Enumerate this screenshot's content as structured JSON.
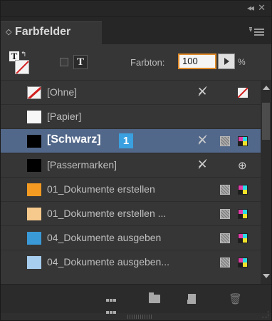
{
  "titlebar": {
    "collapse_glyph": "◂◂",
    "close_glyph": "✕"
  },
  "panel": {
    "tab_title": "Farbfelder",
    "tab_icon": "◇",
    "menu_icon": "panel-menu-icon"
  },
  "toolbar": {
    "text_button_label": "T",
    "fill_text_glyph": "T",
    "swap_glyph": "↰",
    "tint_label": "Farbton:",
    "tint_value": "100",
    "tint_unit": "%"
  },
  "swatches": [
    {
      "name": "[Ohne]",
      "swatch_color": "none",
      "icons": [
        "noedit",
        "none-mode"
      ]
    },
    {
      "name": "[Papier]",
      "swatch_color": "#f7f7f7",
      "icons": []
    },
    {
      "name": "[Schwarz]",
      "swatch_color": "#000000",
      "selected": true,
      "badge": "1",
      "icons": [
        "noedit",
        "process",
        "cmyk"
      ]
    },
    {
      "name": "[Passermarken]",
      "swatch_color": "#000000",
      "icons": [
        "noedit",
        "registration"
      ]
    },
    {
      "name": "01_Dokumente erstellen",
      "swatch_color": "#f29a22",
      "icons": [
        "process",
        "cmyk"
      ]
    },
    {
      "name": "01_Dokumente erstellen ...",
      "swatch_color": "#f6c98c",
      "icons": [
        "process",
        "cmyk"
      ]
    },
    {
      "name": "04_Dokumente ausgeben",
      "swatch_color": "#3a9ad8",
      "icons": [
        "process",
        "cmyk"
      ]
    },
    {
      "name": "04_Dokumente ausgeben...",
      "swatch_color": "#a7cdef",
      "icons": [
        "process",
        "cmyk"
      ]
    }
  ],
  "glyphs": {
    "noedit": "✕̸",
    "registration": "⊕",
    "trash": "🗑"
  }
}
